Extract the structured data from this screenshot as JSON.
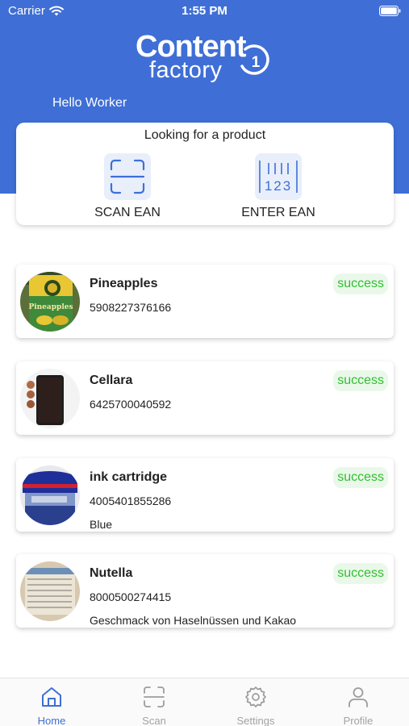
{
  "status_bar": {
    "carrier": "Carrier",
    "time": "1:55 PM"
  },
  "logo": {
    "word1": "Content",
    "word2": "factory",
    "badge": "1"
  },
  "greeting": "Hello Worker",
  "search": {
    "title": "Looking for a product",
    "scan_label": "SCAN EAN",
    "enter_label": "ENTER EAN",
    "enter_icon_digits": "123"
  },
  "products": [
    {
      "name": "Pineapples",
      "ean": "5908227376166",
      "description": "",
      "status": "success",
      "thumb_text": "Pineapples"
    },
    {
      "name": "Cellara",
      "ean": "6425700040592",
      "description": "",
      "status": "success"
    },
    {
      "name": "ink cartridge",
      "ean": "4005401855286",
      "description": "Blue",
      "status": "success"
    },
    {
      "name": "Nutella",
      "ean": "8000500274415",
      "description": "Geschmack von Haselnüssen und Kakao",
      "status": "success"
    }
  ],
  "tabs": [
    {
      "label": "Home",
      "icon": "home-icon",
      "active": true
    },
    {
      "label": "Scan",
      "icon": "scan-icon",
      "active": false
    },
    {
      "label": "Settings",
      "icon": "gear-icon",
      "active": false
    },
    {
      "label": "Profile",
      "icon": "person-icon",
      "active": false
    }
  ],
  "colors": {
    "primary": "#3f6fd6",
    "success_text": "#30bf30",
    "success_bg": "#eaf8ea",
    "tab_inactive": "#a3a3a3",
    "icon_tile": "#e8effb"
  }
}
